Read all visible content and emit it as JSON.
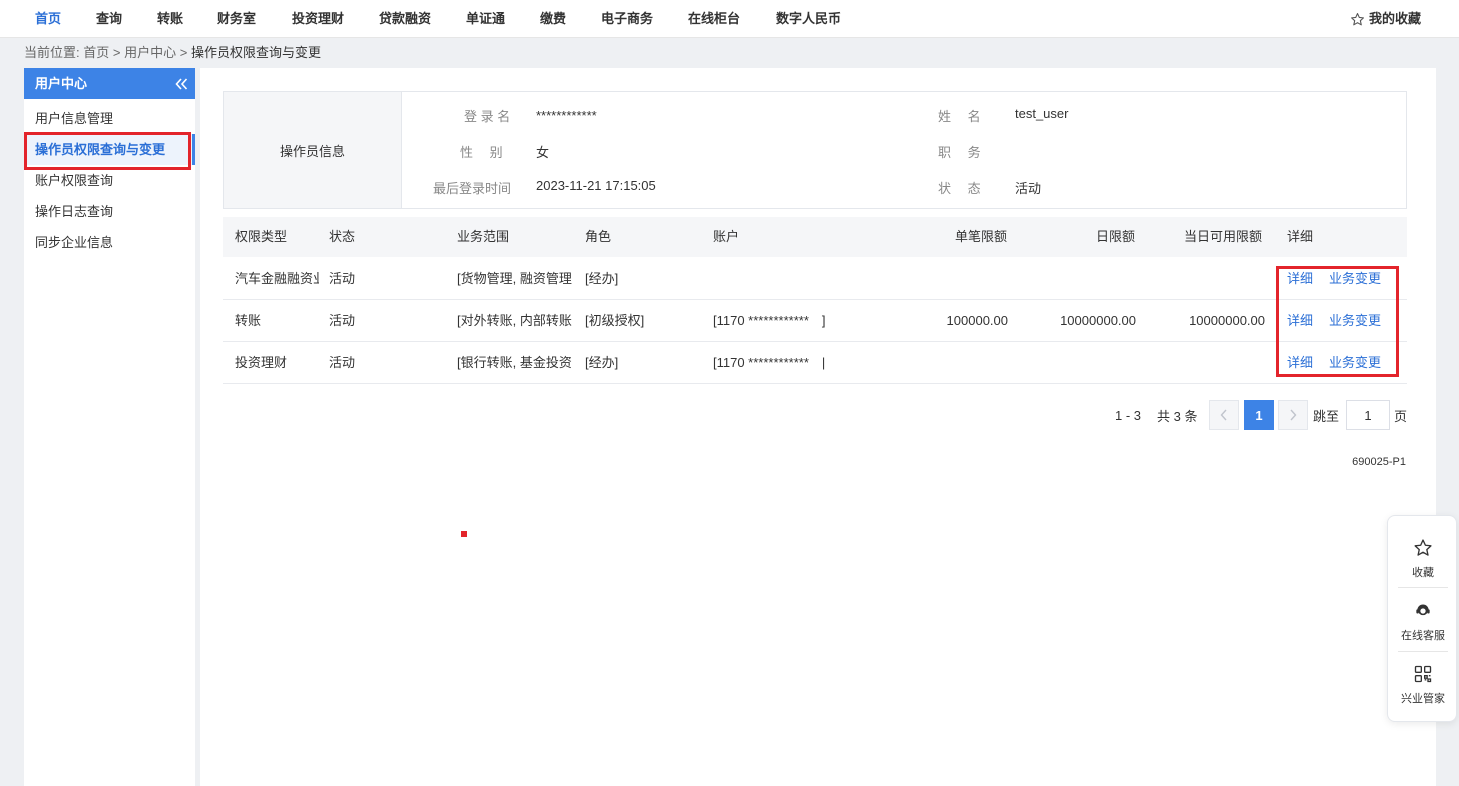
{
  "nav": {
    "items": [
      "首页",
      "查询",
      "转账",
      "财务室",
      "投资理财",
      "贷款融资",
      "单证通",
      "缴费",
      "电子商务",
      "在线柜台",
      "数字人民币"
    ],
    "favorites": "我的收藏",
    "accent": "#2b6fd6"
  },
  "breadcrumb": {
    "prefix": "当前位置:",
    "items": [
      "首页",
      "用户中心",
      "操作员权限查询与变更"
    ],
    "sep": ">"
  },
  "sidebar": {
    "title": "用户中心",
    "items": [
      "用户信息管理",
      "操作员权限查询与变更",
      "账户权限查询",
      "操作日志查询",
      "同步企业信息"
    ],
    "active_index": 1
  },
  "operator": {
    "section_label": "操作员信息",
    "login_label": "登 录 名",
    "login_value": "************",
    "name_label": "姓　 名",
    "name_value": "test_user",
    "gender_label": "性　 别",
    "gender_value": "女",
    "position_label": "职　 务",
    "position_value": "",
    "last_login_label": "最后登录时间",
    "last_login_value": "2023-11-21 17:15:05",
    "status_label": "状　 态",
    "status_value": "活动"
  },
  "table": {
    "columns": [
      "权限类型",
      "状态",
      "业务范围",
      "角色",
      "账户",
      "单笔限额",
      "日限额",
      "当日可用限额",
      "详细"
    ],
    "rows": [
      {
        "type": "汽车金融融资业务",
        "status": "活动",
        "scope": "[货物管理, 融资管理",
        "role": "[经办]",
        "account": "",
        "single": "",
        "daily": "",
        "available": "",
        "detail": "详细",
        "change": "业务变更"
      },
      {
        "type": "转账",
        "status": "活动",
        "scope": "[对外转账, 内部转账",
        "role": "[初级授权]",
        "account": "[1170 ************　]",
        "single": "100000.00",
        "daily": "10000000.00",
        "available": "10000000.00",
        "detail": "详细",
        "change": "业务变更"
      },
      {
        "type": "投资理财",
        "status": "活动",
        "scope": "[银行转账, 基金投资",
        "role": "[经办]",
        "account": "[1170 ************　|",
        "single": "",
        "daily": "",
        "available": "",
        "detail": "详细",
        "change": "业务变更"
      }
    ]
  },
  "pagination": {
    "range": "1 - 3",
    "total": "共 3 条",
    "current": "1",
    "jump_label": "跳至",
    "jump_value": "1",
    "page_unit": "页"
  },
  "page_code": "690025-P1",
  "float_bar": {
    "items": [
      {
        "label": "收藏",
        "icon": "star-icon"
      },
      {
        "label": "在线客服",
        "icon": "customer-service-icon"
      },
      {
        "label": "兴业管家",
        "icon": "grid-app-icon"
      }
    ]
  },
  "colors": {
    "highlight": "#e3242b",
    "sidebar_header": "#3d83e6",
    "link": "#2b6fd6"
  }
}
